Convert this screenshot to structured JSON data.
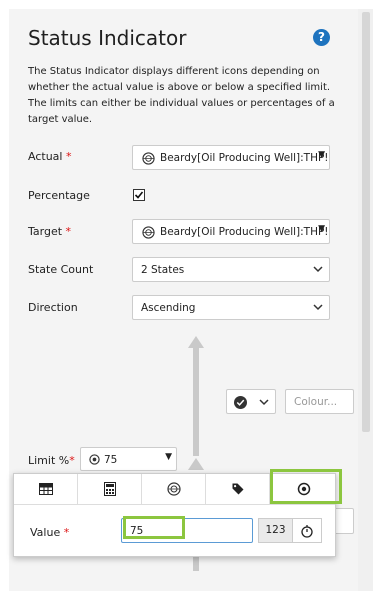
{
  "title": "Status Indicator",
  "description": "The Status Indicator displays different icons depending on whether the actual value is above or below a specified limit. The limits can either be individual values or percentages of a target value.",
  "form": {
    "actual_label": "Actual",
    "actual_value": "Beardy[Oil Producing Well]:THP!",
    "percentage_label": "Percentage",
    "target_label": "Target",
    "target_value": "Beardy[Oil Producing Well]:THP!",
    "state_count_label": "State Count",
    "state_count_value": "2 States",
    "direction_label": "Direction",
    "direction_value": "Ascending",
    "required_mark": "*"
  },
  "state": {
    "colour_placeholder": "Colour..."
  },
  "limit": {
    "label": "Limit %",
    "value": "75"
  },
  "popup": {
    "value_label": "Value",
    "value_input": "75",
    "type_button": "123"
  }
}
